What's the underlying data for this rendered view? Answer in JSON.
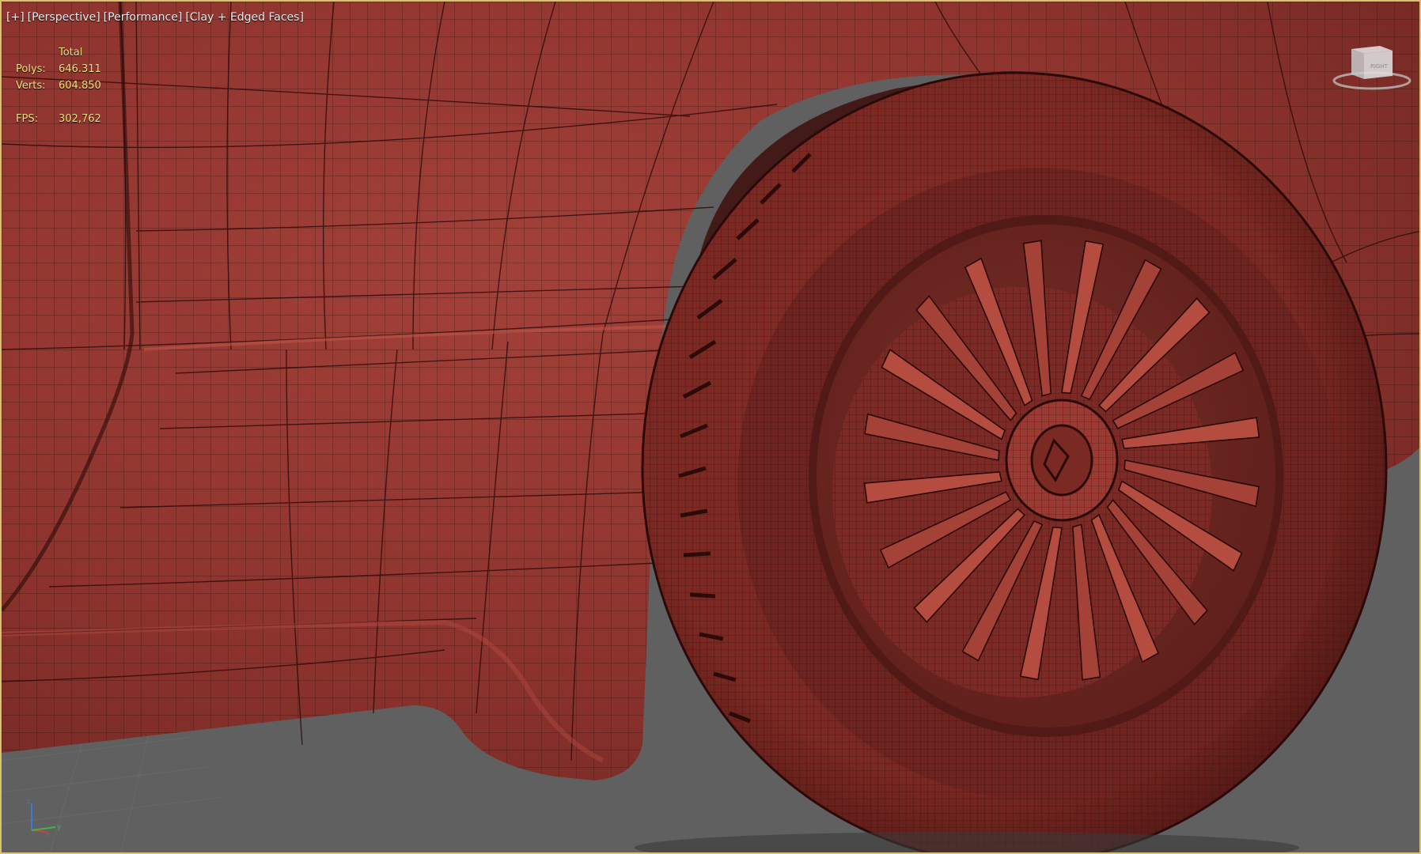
{
  "viewport": {
    "labels": [
      "[+]",
      "[Perspective]",
      "[Performance]",
      "[Clay + Edged Faces]"
    ],
    "stats": {
      "header": "Total",
      "rows": [
        {
          "key": "Polys:",
          "value": "646.311"
        },
        {
          "key": "Verts:",
          "value": "604.850"
        },
        {
          "key": "FPS:",
          "value": "302,762"
        }
      ]
    },
    "viewcube": {
      "face_label": "RIGHT",
      "icon": "viewcube-icon"
    },
    "axis": {
      "x": "x",
      "y": "y",
      "z": "z"
    }
  },
  "colors": {
    "clay": "#9a3a33",
    "clay_dark": "#5b1d1a",
    "ground": "#5f5f5f",
    "border": "#d6c36a",
    "stats_text": "#f2e27a"
  }
}
